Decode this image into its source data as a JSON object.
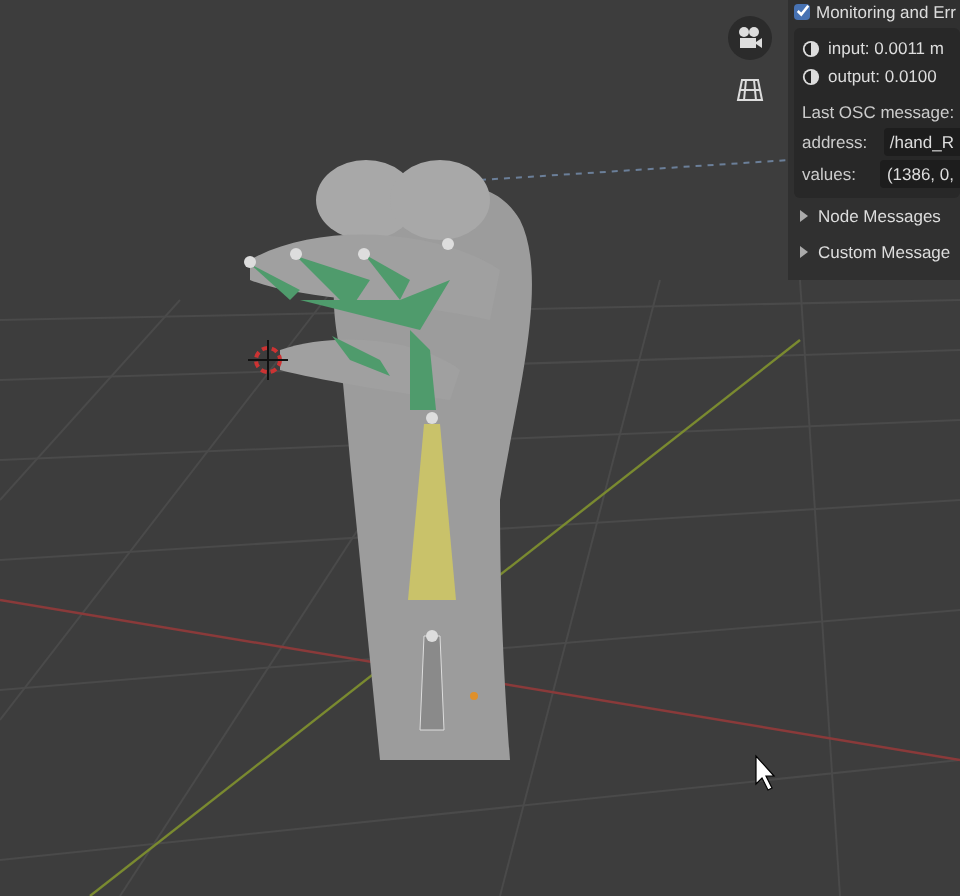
{
  "panel": {
    "header": {
      "label": "Monitoring and Err",
      "checked": true
    },
    "rows": [
      {
        "label": "input: 0.0011 m"
      },
      {
        "label": "output: 0.0100"
      }
    ],
    "last_message_label": "Last OSC message:",
    "fields": [
      {
        "label": "address:",
        "value": "/hand_R"
      },
      {
        "label": "values:",
        "value": "(1386, 0,"
      }
    ],
    "sections": [
      {
        "label": "Node Messages",
        "expanded": false
      },
      {
        "label": "Custom Message",
        "expanded": false
      }
    ]
  }
}
